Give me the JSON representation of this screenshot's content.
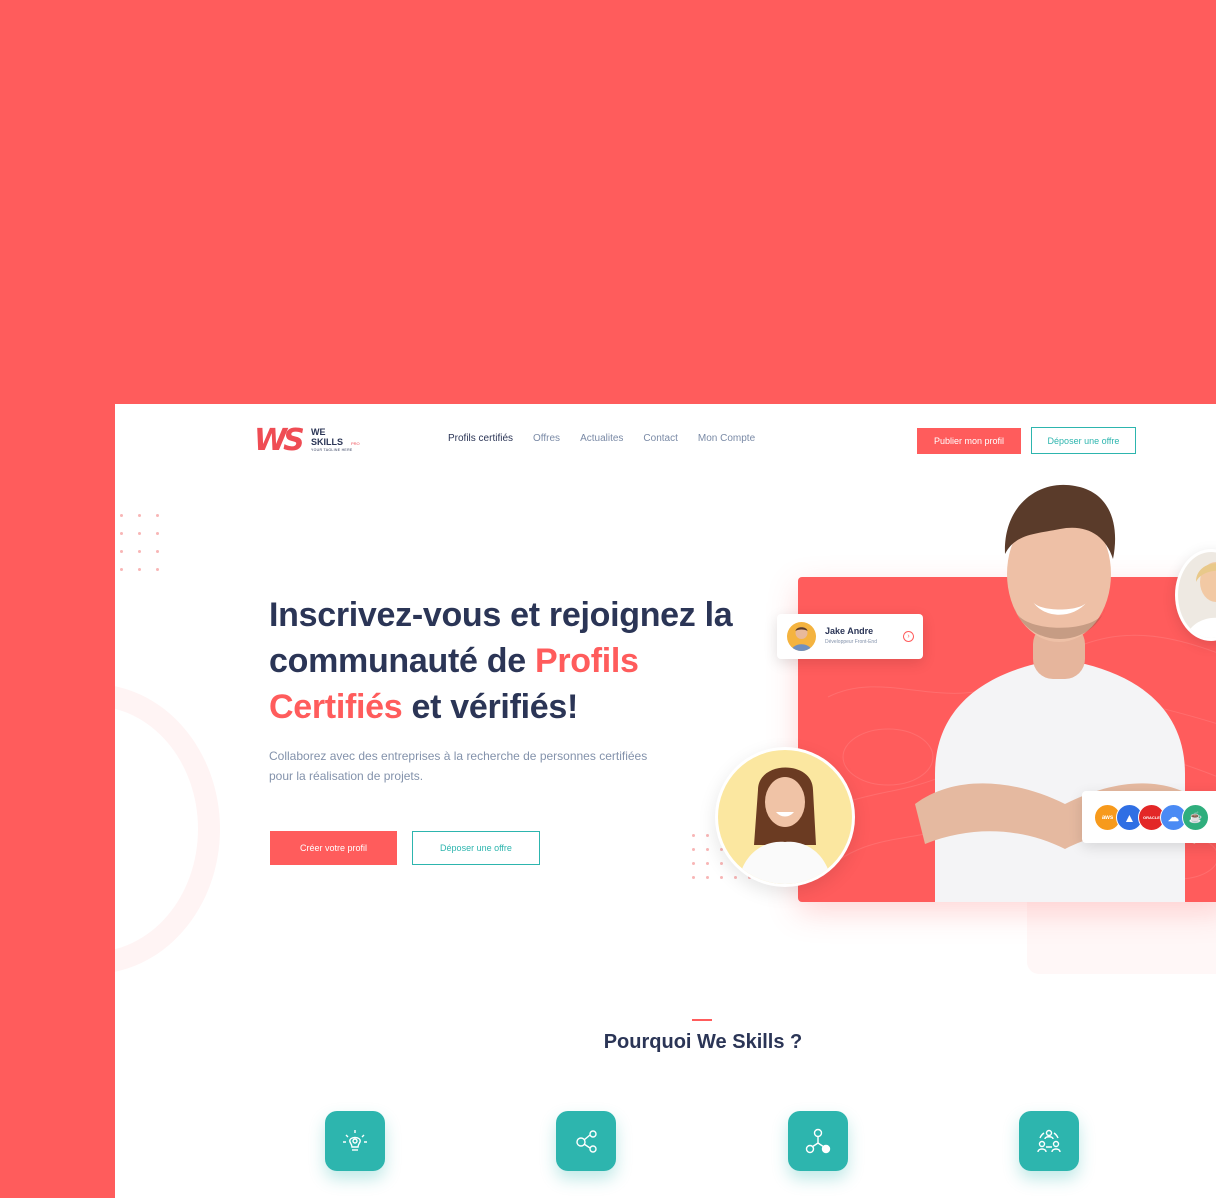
{
  "brand": {
    "logo_mark": "WS",
    "line1": "WE",
    "line2": "SKILLS",
    "suffix": "PRO",
    "tagline": "YOUR TAGLINE HERE"
  },
  "nav": {
    "items": [
      {
        "label": "Profils certifiés",
        "active": true
      },
      {
        "label": "Offres",
        "active": false
      },
      {
        "label": "Actualites",
        "active": false
      },
      {
        "label": "Contact",
        "active": false
      },
      {
        "label": "Mon Compte",
        "active": false
      }
    ]
  },
  "header_actions": {
    "publish_label": "Publier mon profil",
    "deposit_label": "Déposer une offre"
  },
  "hero": {
    "title_part1": "Inscrivez-vous et rejoignez la communauté de ",
    "title_accent": "Profils Certifiés",
    "title_part2": " et vérifiés!",
    "subtitle": "Collaborez avec des entreprises à la recherche de personnes certifiées pour la réalisation de projets.",
    "cta_primary": "Créer votre profil",
    "cta_secondary": "Déposer une offre"
  },
  "profile_card": {
    "name": "Jake Andre",
    "role": "Développeur Front-End"
  },
  "tech_logos": [
    {
      "label": "aws",
      "color": "#f79a1c"
    },
    {
      "label": "Azure",
      "color": "#2f6fe4"
    },
    {
      "label": "ORACLE",
      "color": "#e32727"
    },
    {
      "label": "GCloud",
      "color": "#4a8af4"
    },
    {
      "label": "Java",
      "color": "#2fae7d"
    }
  ],
  "section": {
    "title": "Pourquoi We Skills ?",
    "features": [
      {
        "icon": "lightbulb-icon"
      },
      {
        "icon": "share-nodes-icon"
      },
      {
        "icon": "network-icon"
      },
      {
        "icon": "team-icon"
      }
    ]
  },
  "colors": {
    "accent": "#ff5c5c",
    "teal": "#2db5ae",
    "navy": "#2b3556"
  }
}
